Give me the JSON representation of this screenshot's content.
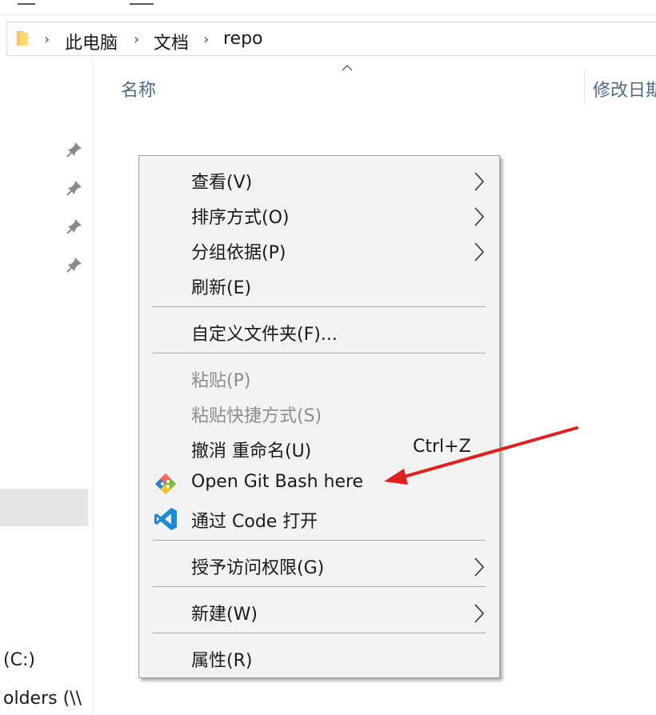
{
  "address_bar": {
    "breadcrumbs": [
      "此电脑",
      "文档",
      "repo"
    ]
  },
  "nav": {
    "drive_label": "(C:)",
    "folders_label": "olders (\\\\"
  },
  "columns": {
    "name": "名称",
    "modified": "修改日期"
  },
  "context_menu": {
    "items": [
      {
        "label": "查看(V)",
        "submenu": true
      },
      {
        "label": "排序方式(O)",
        "submenu": true
      },
      {
        "label": "分组依据(P)",
        "submenu": true
      },
      {
        "label": "刷新(E)"
      },
      {
        "label": "自定义文件夹(F)..."
      },
      {
        "label": "粘贴(P)",
        "disabled": true
      },
      {
        "label": "粘贴快捷方式(S)",
        "disabled": true
      },
      {
        "label": "撤消 重命名(U)",
        "shortcut": "Ctrl+Z"
      },
      {
        "label": "Open Git Bash here",
        "icon": "git-bash-icon"
      },
      {
        "label": "通过 Code 打开",
        "icon": "vscode-icon"
      },
      {
        "label": "授予访问权限(G)",
        "submenu": true
      },
      {
        "label": "新建(W)",
        "submenu": true
      },
      {
        "label": "属性(R)"
      }
    ]
  },
  "colors": {
    "menu_bg": "#f2f2f2",
    "annotation_arrow": "#e02020",
    "column_header": "#4d6a8a"
  }
}
